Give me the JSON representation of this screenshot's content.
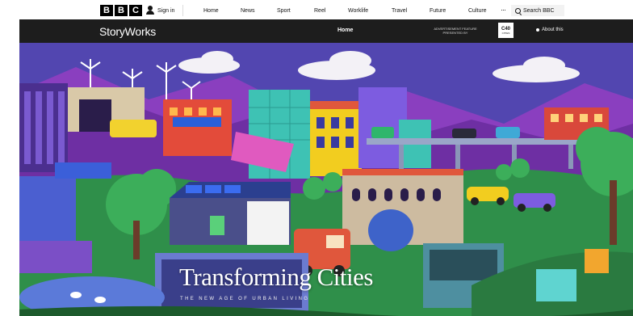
{
  "bbc_nav": {
    "logo_letters": [
      "B",
      "B",
      "C"
    ],
    "signin": "Sign in",
    "links": [
      "Home",
      "News",
      "Sport",
      "Reel",
      "Worklife",
      "Travel",
      "Future",
      "Culture"
    ],
    "more": "···",
    "search_label": "Search BBC"
  },
  "storyworks_bar": {
    "brand": "StoryWorks",
    "home": "Home",
    "ad_line1": "ADVERTISEMENT FEATURE",
    "ad_line2": "PRESENTED BY",
    "sponsor_top": "C40",
    "sponsor_bottom": "CITIES",
    "about": "About this"
  },
  "hero": {
    "title": "Transforming Cities",
    "subtitle": "THE NEW AGE OF URBAN LIVING"
  },
  "colors": {
    "bar_bg": "#1d1d1d",
    "sky": "#5b4db8",
    "mountain": "#8a3fbf",
    "grass": "#2f8f4a"
  }
}
